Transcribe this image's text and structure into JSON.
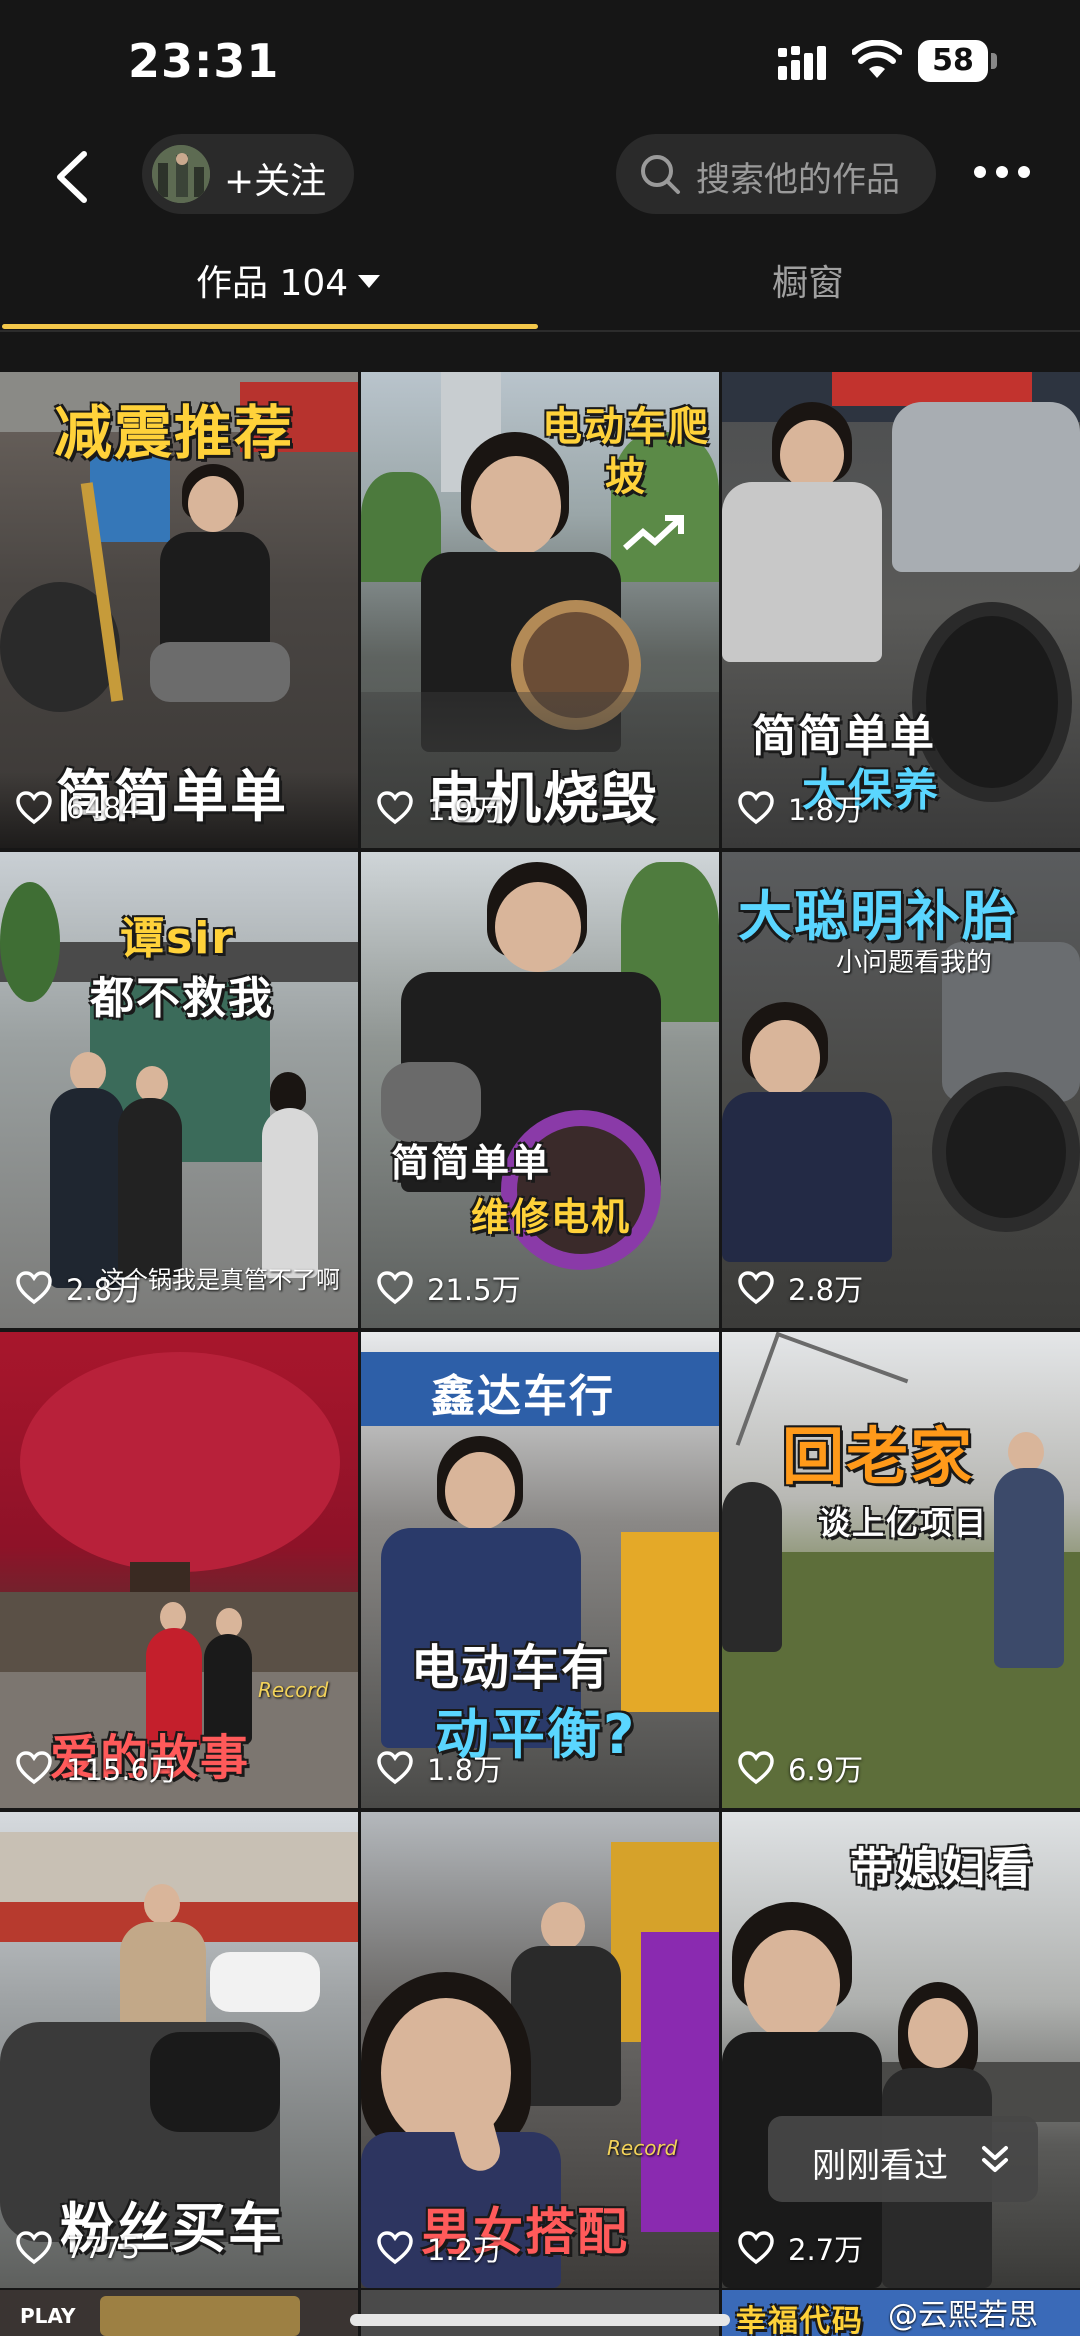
{
  "status_bar": {
    "time": "23:31",
    "battery": "58"
  },
  "nav": {
    "follow_label": "+关注",
    "search_placeholder": "搜索他的作品"
  },
  "tabs": {
    "works": "作品 104",
    "shop": "橱窗"
  },
  "tiles": [
    {
      "caption": "减震推荐",
      "caption2": "简简单单",
      "likes": "6484"
    },
    {
      "caption": "电动车爬坡",
      "caption2": "电机烧毁",
      "likes": "1.9万"
    },
    {
      "caption": "简简单单",
      "caption2": "大保养",
      "likes": "1.8万"
    },
    {
      "caption": "谭sir",
      "caption2": "都不救我",
      "subtitle": "这个锅我是真管不了啊",
      "likes": "2.8万"
    },
    {
      "caption": "简简单单",
      "caption2": "维修电机",
      "likes": "21.5万"
    },
    {
      "caption": "大聪明补胎",
      "subtitle": "小问题看我的",
      "likes": "2.8万"
    },
    {
      "caption": "爱的故事",
      "badge": "Record",
      "likes": "115.6万"
    },
    {
      "caption": "电动车有",
      "caption2": "动平衡?",
      "sign": "鑫达车行",
      "likes": "1.8万"
    },
    {
      "caption": "回老家",
      "caption2": "谈上亿项目",
      "likes": "6.9万"
    },
    {
      "caption": "粉丝买车",
      "likes": "7775"
    },
    {
      "caption": "男女搭配",
      "badge": "Record",
      "likes": "1.2万"
    },
    {
      "caption": "带媳妇看",
      "likes": "2.7万"
    }
  ],
  "recent": {
    "label": "刚刚看过"
  },
  "peek": {
    "play": "PLAY",
    "caption3": "幸福代码"
  },
  "watermark": "@云熙若思",
  "colors": {
    "accent": "#f3c74a",
    "background": "#161616",
    "pill": "#2a2a2a"
  }
}
